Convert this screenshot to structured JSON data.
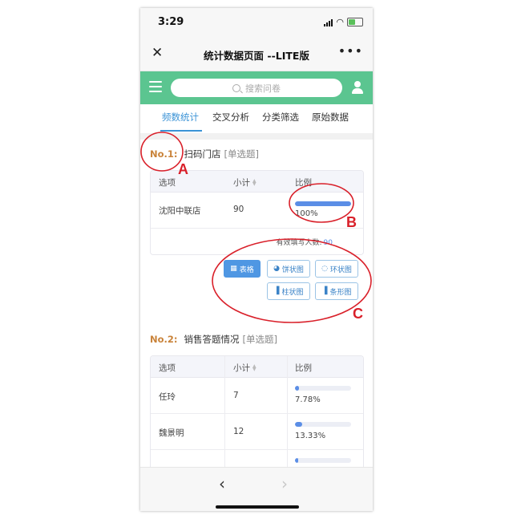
{
  "status_bar": {
    "time": "3:29"
  },
  "nav": {
    "title": "统计数据页面 --LITE版",
    "close_glyph": "✕",
    "more_glyph": "•••"
  },
  "search": {
    "placeholder": "搜索问卷"
  },
  "tabs": [
    {
      "label": "频数统计",
      "active": true
    },
    {
      "label": "交叉分析",
      "active": false
    },
    {
      "label": "分类筛选",
      "active": false
    },
    {
      "label": "原始数据",
      "active": false
    }
  ],
  "table_headers": {
    "option": "选项",
    "count": "小计",
    "ratio": "比例"
  },
  "questions": [
    {
      "no": "No.1:",
      "title": "扫码门店",
      "type": "[单选题]",
      "rows": [
        {
          "option": "沈阳中联店",
          "count": "90",
          "ratio": "100%",
          "fraction": 1.0
        }
      ],
      "footer_label": "有效填写人数:",
      "footer_value": "90"
    },
    {
      "no": "No.2:",
      "title": "销售答题情况",
      "type": "[单选题]",
      "rows": [
        {
          "option": "任玲",
          "count": "7",
          "ratio": "7.78%",
          "fraction": 0.0778
        },
        {
          "option": "魏景明",
          "count": "12",
          "ratio": "13.33%",
          "fraction": 0.1333
        }
      ]
    }
  ],
  "chart_buttons": [
    {
      "label": "表格",
      "icon": "table-icon",
      "active": true
    },
    {
      "label": "饼状图",
      "icon": "pie-icon",
      "active": false
    },
    {
      "label": "环状图",
      "icon": "ring-icon",
      "active": false
    },
    {
      "label": "柱状图",
      "icon": "bar-chart-icon",
      "active": false
    },
    {
      "label": "条形图",
      "icon": "bar-horizontal-icon",
      "active": false
    }
  ],
  "annotations": {
    "a": "A",
    "b": "B",
    "c": "C"
  },
  "colors": {
    "accent_green": "#5bc590",
    "tab_active": "#3b93d6",
    "question_no": "#c9833a",
    "bar": "#5b8ee6",
    "annotation_red": "#d9202a"
  }
}
